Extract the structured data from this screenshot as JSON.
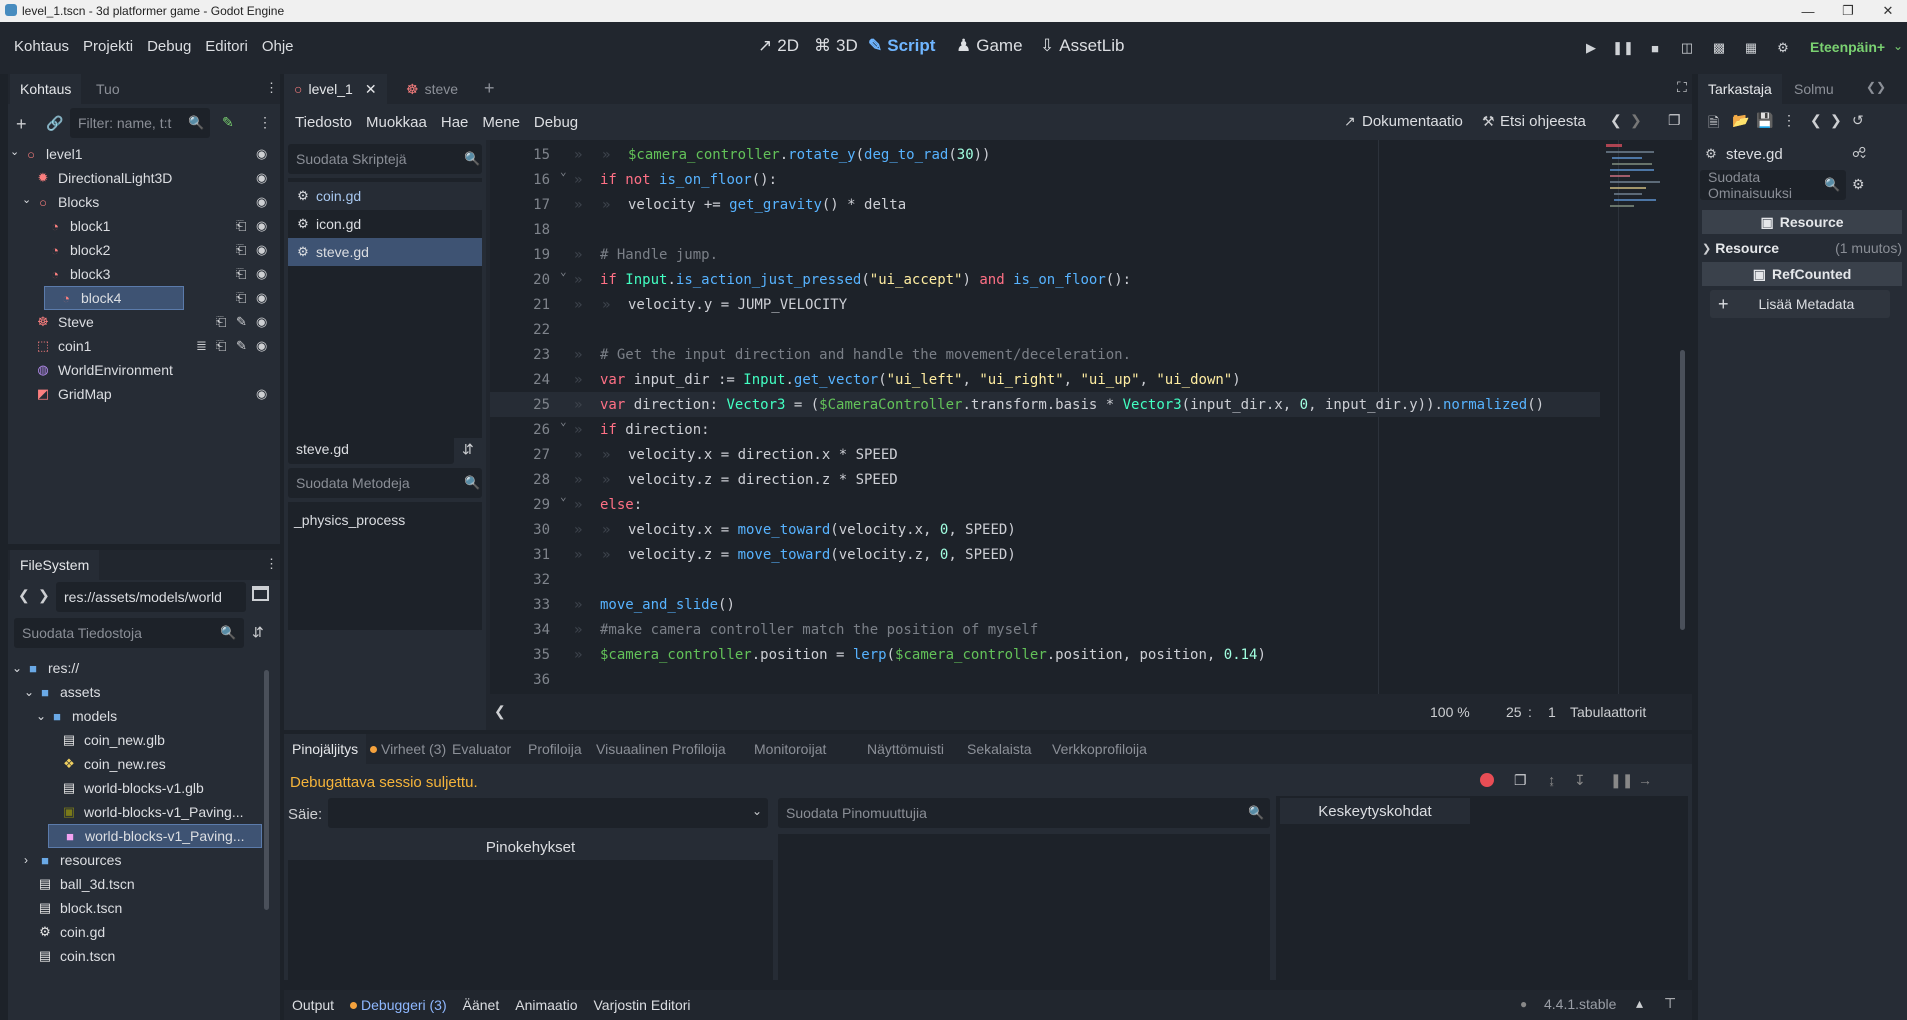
{
  "window": {
    "title": "level_1.tscn - 3d platformer game - Godot Engine"
  },
  "menu": [
    "Kohtaus",
    "Projekti",
    "Debug",
    "Editori",
    "Ohje"
  ],
  "workspaces": [
    {
      "label": "2D",
      "icon": "2d-icon"
    },
    {
      "label": "3D",
      "icon": "3d-icon"
    },
    {
      "label": "Script",
      "icon": "script-icon",
      "active": true
    },
    {
      "label": "Game",
      "icon": "game-icon"
    },
    {
      "label": "AssetLib",
      "icon": "assetlib-icon"
    }
  ],
  "renderer": "Eteenpäin+",
  "scene_dock": {
    "tabs": [
      "Kohtaus",
      "Tuo"
    ],
    "filter_placeholder": "Filter: name, t:t",
    "tree": [
      {
        "label": "level1",
        "icon": "node3d-icon",
        "depth": 0,
        "vis": true
      },
      {
        "label": "DirectionalLight3D",
        "icon": "light-icon",
        "depth": 1,
        "vis": true
      },
      {
        "label": "Blocks",
        "icon": "node3d-icon",
        "depth": 1,
        "vis": true
      },
      {
        "label": "block1",
        "icon": "mesh-icon",
        "depth": 2,
        "vis": true,
        "clap": true
      },
      {
        "label": "block2",
        "icon": "mesh-icon",
        "depth": 2,
        "vis": true,
        "clap": true
      },
      {
        "label": "block3",
        "icon": "mesh-icon",
        "depth": 2,
        "vis": true,
        "clap": true
      },
      {
        "label": "block4",
        "icon": "mesh-icon",
        "depth": 2,
        "vis": true,
        "clap": true,
        "selected": true
      },
      {
        "label": "Steve",
        "icon": "character-icon",
        "depth": 1,
        "vis": true,
        "clap": true,
        "script": true
      },
      {
        "label": "coin1",
        "icon": "area-icon",
        "depth": 1,
        "vis": true,
        "clap": true,
        "signal": true,
        "script": true
      },
      {
        "label": "WorldEnvironment",
        "icon": "world-icon",
        "depth": 1
      },
      {
        "label": "GridMap",
        "icon": "gridmap-icon",
        "depth": 1,
        "vis": true
      }
    ]
  },
  "filesystem": {
    "title": "FileSystem",
    "path": "res://assets/models/world",
    "filter_placeholder": "Suodata Tiedostoja",
    "items": [
      {
        "label": "res://",
        "type": "folder",
        "depth": 0
      },
      {
        "label": "assets",
        "type": "folder",
        "depth": 1
      },
      {
        "label": "models",
        "type": "folder",
        "depth": 2
      },
      {
        "label": "coin_new.glb",
        "type": "scene",
        "depth": 3
      },
      {
        "label": "coin_new.res",
        "type": "res",
        "depth": 3
      },
      {
        "label": "world-blocks-v1.glb",
        "type": "scene",
        "depth": 3
      },
      {
        "label": "world-blocks-v1_Paving...",
        "type": "image",
        "depth": 3
      },
      {
        "label": "world-blocks-v1_Paving...",
        "type": "material",
        "depth": 3,
        "selected": true
      },
      {
        "label": "resources",
        "type": "folder",
        "depth": 1
      },
      {
        "label": "ball_3d.tscn",
        "type": "scene",
        "depth": 1
      },
      {
        "label": "block.tscn",
        "type": "scene",
        "depth": 1
      },
      {
        "label": "coin.gd",
        "type": "script",
        "depth": 1
      },
      {
        "label": "coin.tscn",
        "type": "scene",
        "depth": 1
      }
    ]
  },
  "editor_tabs": [
    {
      "label": "level_1",
      "icon": "node3d-icon",
      "active": true,
      "closable": true
    },
    {
      "label": "steve",
      "icon": "character-icon"
    }
  ],
  "script_menu": [
    "Tiedosto",
    "Muokkaa",
    "Hae",
    "Mene",
    "Debug"
  ],
  "script_menu_right": {
    "docs": "Dokumentaatio",
    "help": "Etsi ohjeesta"
  },
  "script_list": {
    "filter_placeholder": "Suodata Skriptejä",
    "items": [
      "coin.gd",
      "icon.gd",
      "steve.gd"
    ],
    "selected": 2,
    "current": "steve.gd",
    "methods_placeholder": "Suodata Metodeja",
    "methods": [
      "_physics_process"
    ]
  },
  "code": [
    {
      "n": "15",
      "indent": 2,
      "tokens": [
        [
          "nd",
          "$camera_controller"
        ],
        [
          "tx",
          "."
        ],
        [
          "fn",
          "rotate_y"
        ],
        [
          "tx",
          "("
        ],
        [
          "fn",
          "deg_to_rad"
        ],
        [
          "tx",
          "("
        ],
        [
          "num",
          "30"
        ],
        [
          "tx",
          "))"
        ]
      ]
    },
    {
      "n": "16",
      "indent": 1,
      "fold": true,
      "tokens": [
        [
          "kw",
          "if not "
        ],
        [
          "fn",
          "is_on_floor"
        ],
        [
          "tx",
          "():"
        ]
      ]
    },
    {
      "n": "17",
      "indent": 2,
      "tokens": [
        [
          "tx",
          "velocity += "
        ],
        [
          "fn",
          "get_gravity"
        ],
        [
          "tx",
          "() * delta"
        ]
      ]
    },
    {
      "n": "18",
      "indent": 0,
      "tokens": []
    },
    {
      "n": "19",
      "indent": 1,
      "tokens": [
        [
          "cmt",
          "# Handle jump."
        ]
      ]
    },
    {
      "n": "20",
      "indent": 1,
      "fold": true,
      "tokens": [
        [
          "kw",
          "if "
        ],
        [
          "ty",
          "Input"
        ],
        [
          "tx",
          "."
        ],
        [
          "fn",
          "is_action_just_pressed"
        ],
        [
          "tx",
          "("
        ],
        [
          "str",
          "\"ui_accept\""
        ],
        [
          "tx",
          ") "
        ],
        [
          "kw",
          "and "
        ],
        [
          "fn",
          "is_on_floor"
        ],
        [
          "tx",
          "():"
        ]
      ]
    },
    {
      "n": "21",
      "indent": 2,
      "tokens": [
        [
          "tx",
          "velocity.y = JUMP_VELOCITY"
        ]
      ]
    },
    {
      "n": "22",
      "indent": 0,
      "tokens": []
    },
    {
      "n": "23",
      "indent": 1,
      "tokens": [
        [
          "cmt",
          "# Get the input direction and handle the movement/deceleration."
        ]
      ]
    },
    {
      "n": "24",
      "indent": 1,
      "tokens": [
        [
          "kw",
          "var "
        ],
        [
          "tx",
          "input_dir := "
        ],
        [
          "ty",
          "Input"
        ],
        [
          "tx",
          "."
        ],
        [
          "fn",
          "get_vector"
        ],
        [
          "tx",
          "("
        ],
        [
          "str",
          "\"ui_left\""
        ],
        [
          "tx",
          ", "
        ],
        [
          "str",
          "\"ui_right\""
        ],
        [
          "tx",
          ", "
        ],
        [
          "str",
          "\"ui_up\""
        ],
        [
          "tx",
          ", "
        ],
        [
          "str",
          "\"ui_down\""
        ],
        [
          "tx",
          ")"
        ]
      ]
    },
    {
      "n": "25",
      "indent": 1,
      "current": true,
      "tokens": [
        [
          "kw",
          "var "
        ],
        [
          "tx",
          "direction: "
        ],
        [
          "ty",
          "Vector3"
        ],
        [
          "tx",
          " = ("
        ],
        [
          "nd",
          "$CameraController"
        ],
        [
          "tx",
          ".transform.basis * "
        ],
        [
          "ty",
          "Vector3"
        ],
        [
          "tx",
          "(input_dir.x, "
        ],
        [
          "num",
          "0"
        ],
        [
          "tx",
          ", input_dir.y))."
        ],
        [
          "fn",
          "normalized"
        ],
        [
          "tx",
          "()"
        ]
      ]
    },
    {
      "n": "26",
      "indent": 1,
      "fold": true,
      "tokens": [
        [
          "kw",
          "if "
        ],
        [
          "tx",
          "direction:"
        ]
      ]
    },
    {
      "n": "27",
      "indent": 2,
      "tokens": [
        [
          "tx",
          "velocity.x = direction.x * SPEED"
        ]
      ]
    },
    {
      "n": "28",
      "indent": 2,
      "tokens": [
        [
          "tx",
          "velocity.z = direction.z * SPEED"
        ]
      ]
    },
    {
      "n": "29",
      "indent": 1,
      "fold": true,
      "tokens": [
        [
          "kw",
          "else"
        ],
        [
          "tx",
          ":"
        ]
      ]
    },
    {
      "n": "30",
      "indent": 2,
      "tokens": [
        [
          "tx",
          "velocity.x = "
        ],
        [
          "fn",
          "move_toward"
        ],
        [
          "tx",
          "(velocity.x, "
        ],
        [
          "num",
          "0"
        ],
        [
          "tx",
          ", SPEED)"
        ]
      ]
    },
    {
      "n": "31",
      "indent": 2,
      "tokens": [
        [
          "tx",
          "velocity.z = "
        ],
        [
          "fn",
          "move_toward"
        ],
        [
          "tx",
          "(velocity.z, "
        ],
        [
          "num",
          "0"
        ],
        [
          "tx",
          ", SPEED)"
        ]
      ]
    },
    {
      "n": "32",
      "indent": 0,
      "tokens": []
    },
    {
      "n": "33",
      "indent": 1,
      "tokens": [
        [
          "fn",
          "move_and_slide"
        ],
        [
          "tx",
          "()"
        ]
      ]
    },
    {
      "n": "34",
      "indent": 1,
      "tokens": [
        [
          "cmt",
          "#make camera controller match the position of myself"
        ]
      ]
    },
    {
      "n": "35",
      "indent": 1,
      "tokens": [
        [
          "nd",
          "$camera_controller"
        ],
        [
          "tx",
          ".position = "
        ],
        [
          "fn",
          "lerp"
        ],
        [
          "tx",
          "("
        ],
        [
          "nd",
          "$camera_controller"
        ],
        [
          "tx",
          ".position, position, "
        ],
        [
          "num",
          "0.14"
        ],
        [
          "tx",
          ")"
        ]
      ]
    },
    {
      "n": "36",
      "indent": 0,
      "tokens": []
    }
  ],
  "status": {
    "zoom": "100 %",
    "line": "25",
    "col": "1",
    "indent_mode": "Tabulaattorit"
  },
  "debugger": {
    "tabs": [
      "Pinojäljitys",
      "Virheet (3)",
      "Evaluator",
      "Profiloija",
      "Visuaalinen Profiloija",
      "Monitoroijat",
      "Näyttömuisti",
      "Sekalaista",
      "Verkkoprofiloija"
    ],
    "message": "Debugattava sessio suljettu.",
    "thread_label": "Säie:",
    "stack_header": "Pinokehykset",
    "vars_placeholder": "Suodata Pinomuuttujia",
    "breakpoints_header": "Keskeytyskohdat"
  },
  "bottom_bar": {
    "tabs": [
      "Output",
      "Debuggeri (3)",
      "Äänet",
      "Animaatio",
      "Varjostin Editori"
    ],
    "version": "4.4.1.stable"
  },
  "inspector": {
    "tabs": [
      "Tarkastaja",
      "Solmu"
    ],
    "resource_name": "steve.gd",
    "filter_placeholder": "Suodata Ominaisuuksi",
    "section1": "Resource",
    "prop_label": "Resource",
    "prop_value": "(1 muutos)",
    "section2": "RefCounted",
    "add_meta": "Lisää Metadata"
  }
}
